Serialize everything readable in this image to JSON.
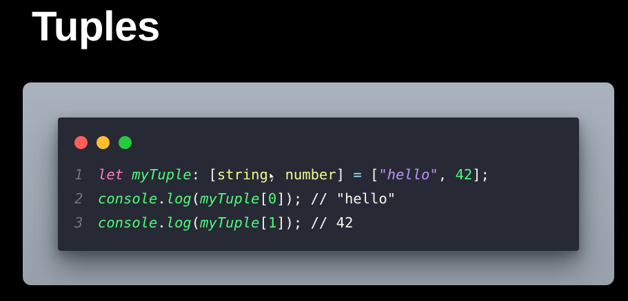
{
  "slide": {
    "title": "Tuples"
  },
  "colors": {
    "background": "#000000",
    "backdrop": "#a3acb6",
    "editor_bg": "#272935",
    "dot_close": "#ff5f56",
    "dot_minimize": "#ffbd2e",
    "dot_maximize": "#27c93f"
  },
  "code": {
    "line_numbers": [
      "1",
      "2",
      "3"
    ],
    "line1": {
      "kw_let": "let",
      "var": "myTuple",
      "colon": ":",
      "open_bracket": "[",
      "type1": "string",
      "comma1": ",",
      "type2": "number",
      "close_bracket": "]",
      "equals": "=",
      "open_bracket2": "[",
      "str_val": "\"hello\"",
      "comma2": ",",
      "num_val": "42",
      "close": "];"
    },
    "line2": {
      "obj": "console",
      "dot": ".",
      "method": "log",
      "open_paren": "(",
      "arg": "myTuple",
      "open_idx": "[",
      "index": "0",
      "close": "]);",
      "comment": "// \"hello\""
    },
    "line3": {
      "obj": "console",
      "dot": ".",
      "method": "log",
      "open_paren": "(",
      "arg": "myTuple",
      "open_idx": "[",
      "index": "1",
      "close": "]);",
      "comment": "// 42"
    }
  }
}
